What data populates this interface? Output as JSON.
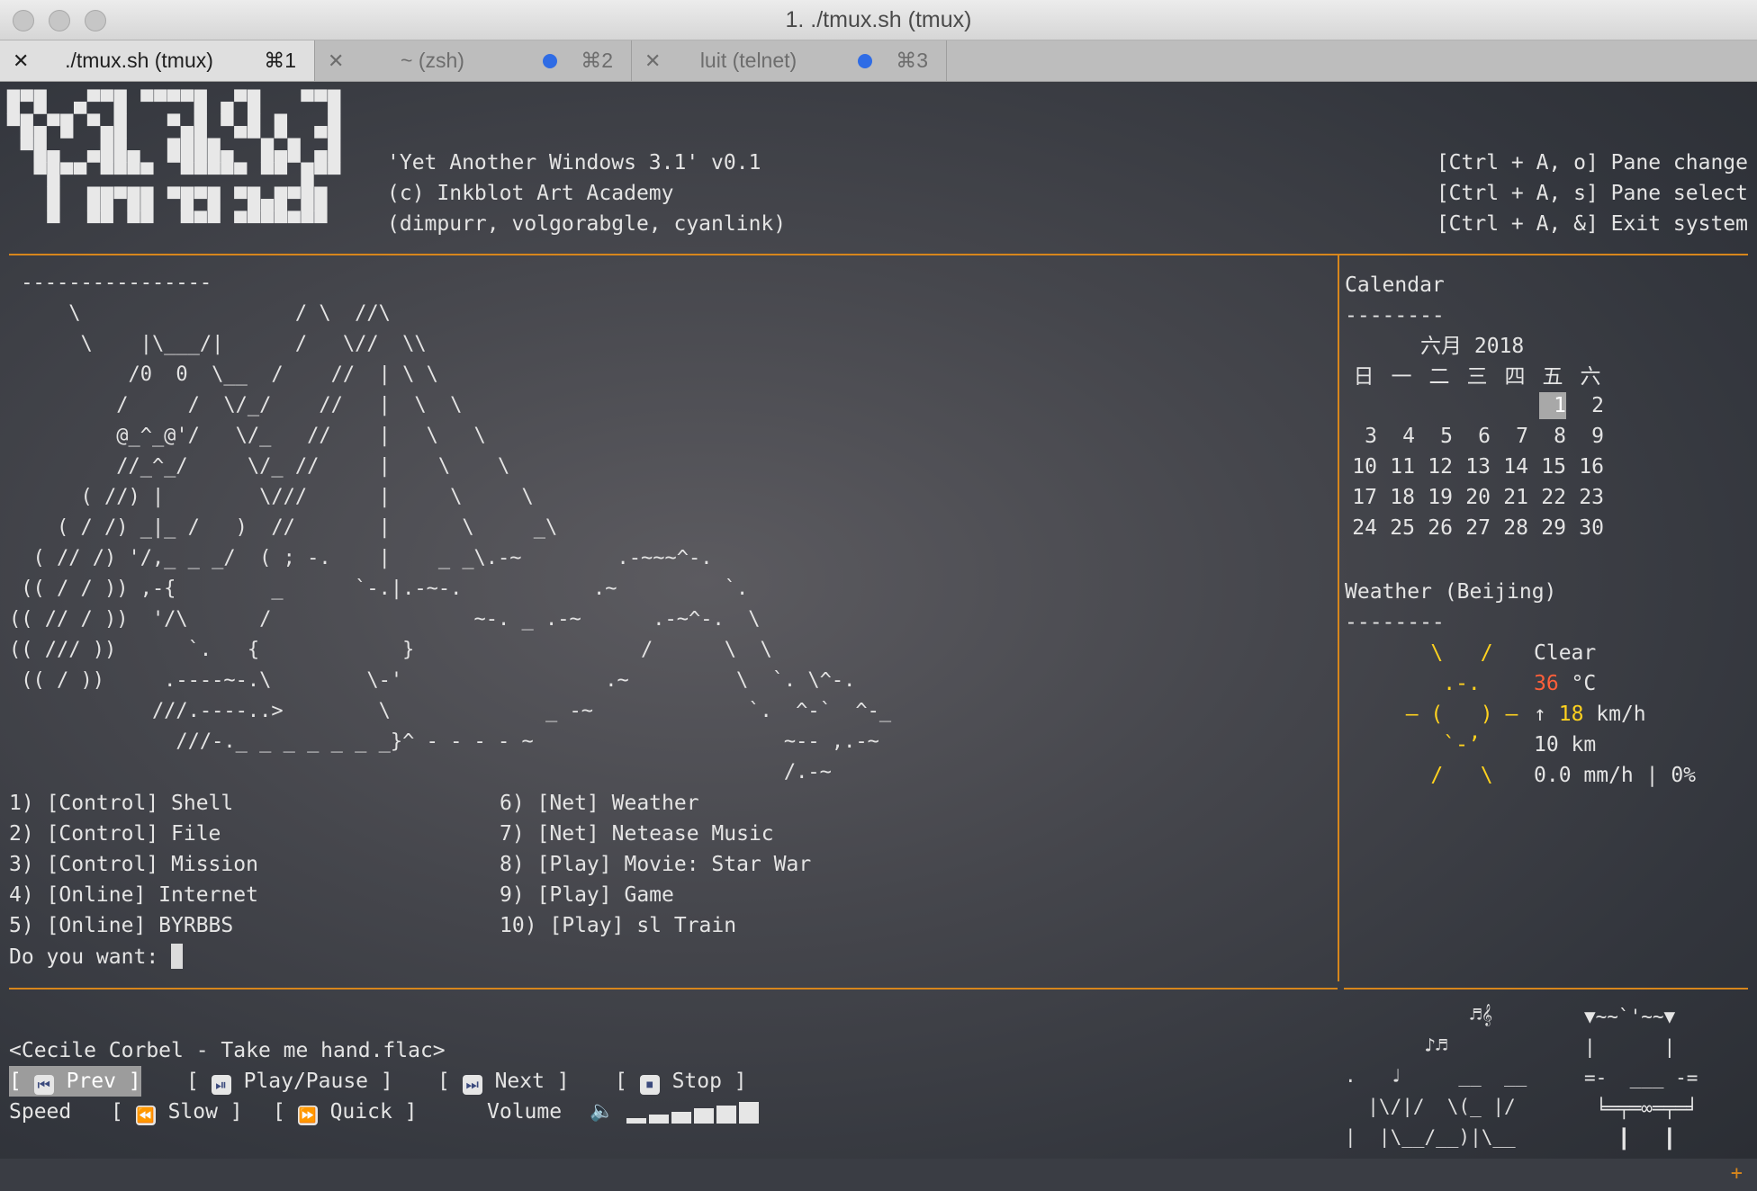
{
  "window": {
    "title": "1. ./tmux.sh (tmux)",
    "tabs": [
      {
        "label": "./tmux.sh (tmux)",
        "shortcut": "⌘1",
        "active": true
      },
      {
        "label": "~ (zsh)",
        "shortcut": "⌘2",
        "active": false
      },
      {
        "label": "luit (telnet)",
        "shortcut": "⌘3",
        "active": false
      }
    ]
  },
  "colors": {
    "accent_line": "#d7861c",
    "tab_activity_dot": "#2f6ce5",
    "weather_sun": "#ffd21f",
    "temperature": "#ff5f3a"
  },
  "logo": {
    "art": "█▀█  ▄▀▀█ ▀▀▀▀█ ▄▀█   ▀▀█\n▀█▄▀█ ▀▄█   ▀▄█ ▀▄█ █  ▄█\n ▀█▄  ▄██▄  ████▄  █▄█ ▄█\n  ▀█▀▀ ▀▀▀▀  ▀▀▀▀▀ ▀▀ █▀▀\n   █  ██▀██ ▀█▀█ ▀█▄█▀██\n   ▀  ▀▀ ▀▀  ▀▀▀ ▀▀▀▀▀▀▀"
  },
  "header": {
    "line1": "'Yet Another Windows 3.1' v0.1",
    "line2": "(c) Inkblot Art Academy",
    "line3": "(dimpurr, volgorabgle, cyanlink)",
    "shortcuts": [
      "[Ctrl + A, o] Pane change",
      "[Ctrl + A, s] Pane select",
      "[Ctrl + A, &] Exit system"
    ]
  },
  "main": {
    "art": " ----------------\n     \\                  / \\  //\\\n      \\    |\\___/|      /   \\//  \\\\\n          /0  0  \\__  /    //  | \\ \\\n         /     /  \\/_/    //   |  \\  \\\n         @_^_@'/   \\/_   //    |   \\   \\\n         //_^_/     \\/_ //     |    \\    \\\n      ( //) |        \\///      |     \\     \\\n    ( / /) _|_ /   )  //       |      \\     _\\\n  ( // /) '/,_ _ _/  ( ; -.    |    _ _\\.-~        .-~~~^-.\n (( / / )) ,-{        _      `-.|.-~-.           .~         `.\n(( // / ))  '/\\      /                 ~-. _ .-~      .-~^-.  \\\n(( /// ))      `.   {            }                   /      \\  \\\n (( / ))     .----~-.\\        \\-'                 .~         \\  `. \\^-.\n            ///.----..>        \\             _ -~             `.  ^-`  ^-_\n              ///-._ _ _ _ _ _ _}^ - - - - ~                     ~-- ,.-~\n                                                                 /.-~",
    "menu_left": [
      "1) [Control] Shell",
      "2) [Control] File",
      "3) [Control] Mission",
      "4) [Online] Internet",
      "5) [Online] BYRBBS"
    ],
    "menu_right": [
      "6) [Net] Weather",
      "7) [Net] Netease Music",
      "8) [Play] Movie: Star War",
      "9) [Play] Game",
      "10) [Play] sl Train"
    ],
    "prompt": "Do you want: "
  },
  "calendar": {
    "title": "Calendar",
    "underline": "--------",
    "month_year": "六月 2018",
    "weekdays": [
      "日",
      "一",
      "二",
      "三",
      "四",
      "五",
      "六"
    ],
    "weeks": [
      [
        "",
        "",
        "",
        "",
        "",
        "1",
        "2"
      ],
      [
        "3",
        "4",
        "5",
        "6",
        "7",
        "8",
        "9"
      ],
      [
        "10",
        "11",
        "12",
        "13",
        "14",
        "15",
        "16"
      ],
      [
        "17",
        "18",
        "19",
        "20",
        "21",
        "22",
        "23"
      ],
      [
        "24",
        "25",
        "26",
        "27",
        "28",
        "29",
        "30"
      ]
    ],
    "today": "1"
  },
  "weather": {
    "title": "Weather (Beijing)",
    "underline": "--------",
    "condition": "Clear",
    "temperature": "36",
    "temperature_unit": " °C",
    "wind_arrow": "↑",
    "wind_speed": "18",
    "wind_unit": " km/h",
    "visibility": "10 km",
    "precipitation": "0.0 mm/h | 0%",
    "icon_name": "sun-icon"
  },
  "music": {
    "now_playing": "<Cecile Corbel - Take me hand.flac>",
    "prev_icon": "⏮",
    "prev_label": "Prev",
    "playpause_icon": "⏯",
    "playpause_label": "Play/Pause",
    "next_icon": "⏭",
    "next_label": "Next",
    "stop_icon": "⏹",
    "stop_label": "Stop",
    "speed_label": "Speed",
    "slow_icon": "⏪",
    "slow_label": "Slow",
    "quick_icon": "⏩",
    "quick_label": "Quick",
    "volume_label": "Volume",
    "volume_icon": "🔈",
    "volume_bars": 6
  },
  "decor": {
    "birds": "           ♬𝄞\n       ♪♬\n.   ♩     __  __\n  |\\/|/  \\(_ |/\n|  |\\__/__)|\\__",
    "table": "▼~~`'~~▼\n|      |\n=-  ___ -=\n ╘═╤═∞═╤═╛\n   ┃   ┃"
  }
}
